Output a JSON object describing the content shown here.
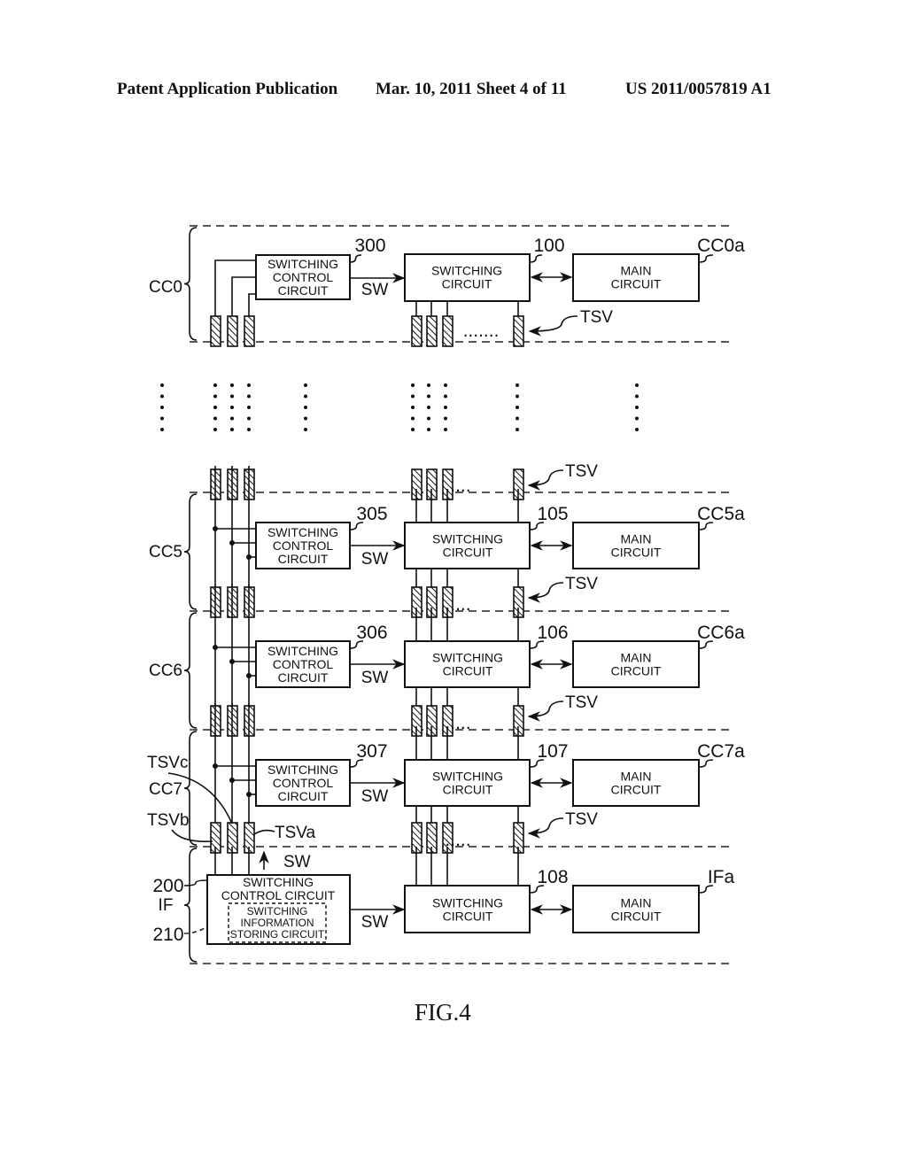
{
  "header": {
    "publication": "Patent Application Publication",
    "date_sheet": "Mar. 10, 2011  Sheet 4 of 11",
    "number": "US 2011/0057819 A1"
  },
  "figure_label": "FIG.4",
  "groups": [
    {
      "id": "CC0",
      "label": "CC0",
      "control_num": "300",
      "switch_num": "100",
      "main_ref": "CC0a"
    },
    {
      "id": "CC5",
      "label": "CC5",
      "control_num": "305",
      "switch_num": "105",
      "main_ref": "CC5a"
    },
    {
      "id": "CC6",
      "label": "CC6",
      "control_num": "306",
      "switch_num": "106",
      "main_ref": "CC6a"
    },
    {
      "id": "CC7",
      "label": "CC7",
      "control_num": "307",
      "switch_num": "107",
      "main_ref": "CC7a"
    }
  ],
  "interface": {
    "label": "IF",
    "control_num": "200",
    "storing_num": "210",
    "switch_num": "108",
    "main_ref": "IFa",
    "control_text": [
      "SWITCHING",
      "CONTROL CIRCUIT"
    ],
    "storing_text": [
      "SWITCHING",
      "INFORMATION",
      "STORING CIRCUIT"
    ]
  },
  "texts": {
    "control_circuit": [
      "SWITCHING",
      "CONTROL",
      "CIRCUIT"
    ],
    "switching_circuit": [
      "SWITCHING",
      "CIRCUIT"
    ],
    "main_circuit": [
      "MAIN",
      "CIRCUIT"
    ],
    "sw": "SW",
    "tsv": "TSV",
    "tsva": "TSVa",
    "tsvb": "TSVb",
    "tsvc": "TSVc"
  }
}
